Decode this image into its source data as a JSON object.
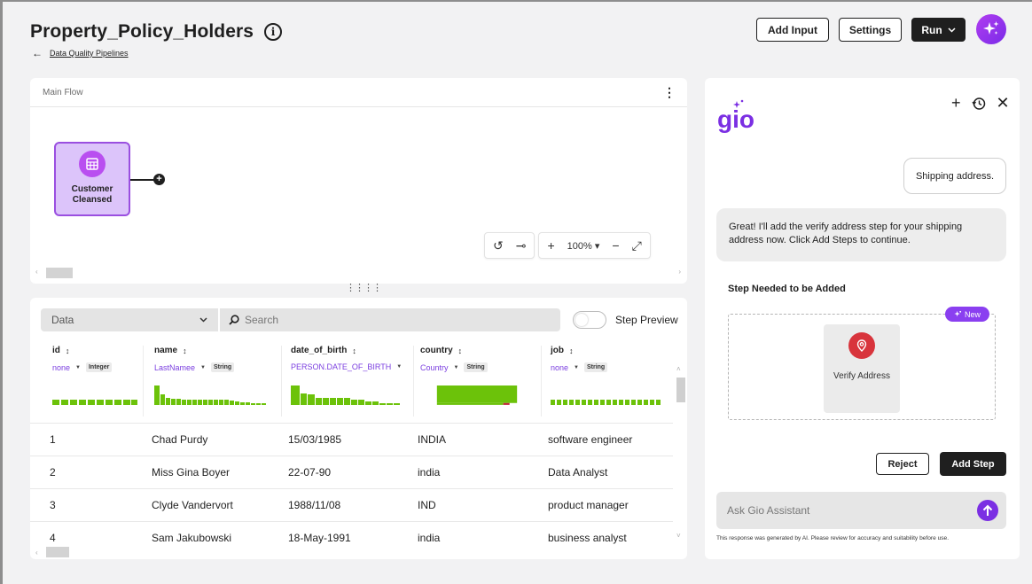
{
  "header": {
    "title": "Property_Policy_Holders",
    "breadcrumb": "Data Quality Pipelines",
    "buttons": {
      "add_input": "Add Input",
      "settings": "Settings",
      "run": "Run"
    }
  },
  "flow": {
    "label": "Main Flow",
    "node_label": "Customer Cleansed",
    "zoom": "100%"
  },
  "data_panel": {
    "selector": "Data",
    "search_placeholder": "Search",
    "toggle_label": "Step Preview",
    "toggle_on": false,
    "columns": [
      {
        "name": "id",
        "semantic": "none",
        "type": "Integer"
      },
      {
        "name": "name",
        "semantic": "LastNamee",
        "type": "String"
      },
      {
        "name": "date_of_birth",
        "semantic": "PERSON.DATE_OF_BIRTH",
        "type": ""
      },
      {
        "name": "country",
        "semantic": "Country",
        "type": "String"
      },
      {
        "name": "job",
        "semantic": "none",
        "type": "String"
      }
    ],
    "rows": [
      [
        "1",
        "Chad Purdy",
        "15/03/1985",
        "INDIA",
        "software engineer"
      ],
      [
        "2",
        "Miss Gina Boyer",
        "22-07-90",
        "india",
        "Data Analyst"
      ],
      [
        "3",
        "Clyde Vandervort",
        "1988/11/08",
        "IND",
        "product manager"
      ],
      [
        "4",
        "Sam Jakubowski",
        "18-May-1991",
        "india",
        "business analyst"
      ]
    ]
  },
  "gio": {
    "logo": "gio",
    "user_message": "Shipping address.",
    "ai_message": "Great! I'll add the verify address step for your shipping address now. Click Add Steps to continue.",
    "step_heading": "Step Needed to be Added",
    "new_badge": "New",
    "step_card_label": "Verify Address",
    "reject_label": "Reject",
    "add_step_label": "Add Step",
    "ask_placeholder": "Ask Gio Assistant",
    "disclaimer": "This response was generated by AI. Please review for accuracy and suitability before use."
  },
  "colors": {
    "accent_purple": "#8a3ff0",
    "node_fill": "#dcc4fa",
    "histogram_green": "#6cc20a",
    "step_icon_red": "#d8343c"
  }
}
